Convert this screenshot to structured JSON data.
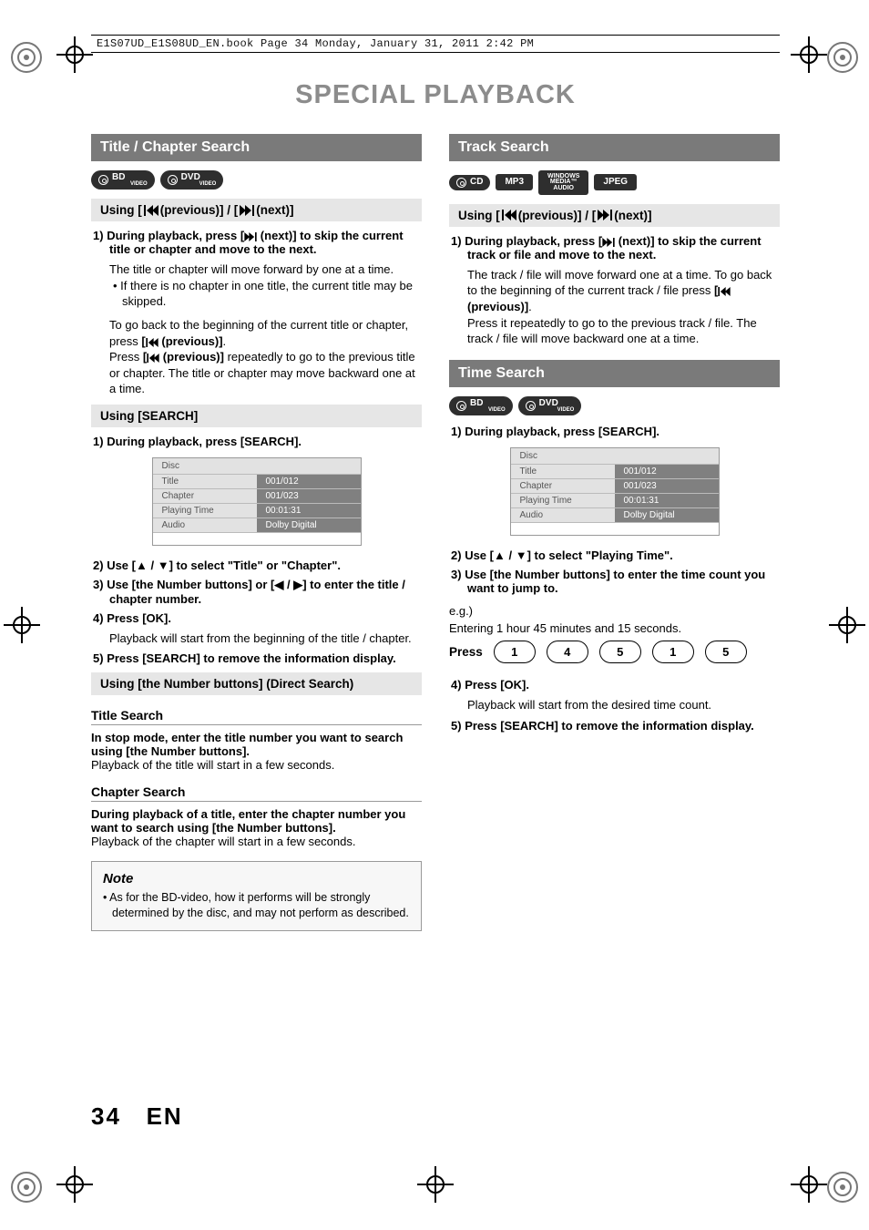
{
  "bookline": "E1S07UD_E1S08UD_EN.book  Page 34  Monday, January 31, 2011  2:42 PM",
  "main_title": "SPECIAL PLAYBACK",
  "icons": {
    "prev": "|◀◀ (previous)",
    "next": "▶▶| (next)",
    "up": "▲",
    "down": "▼",
    "left": "◀",
    "right": "▶"
  },
  "left": {
    "section_title": "Title / Chapter Search",
    "media": [
      "BD VIDEO",
      "DVD VIDEO"
    ],
    "sub1_prefix": "Using [",
    "sub1_mid": " (previous)] / [",
    "sub1_suffix": " (next)]",
    "s1": {
      "num": "1)",
      "bold_a": "During playback, press [",
      "bold_b": " (next)] to skip the current title or chapter and move to the next.",
      "line2": "The title or chapter will move forward by one at a time.",
      "bullet": "If there is no chapter in one title, the current title may be skipped.",
      "line3a": "To go back to the beginning of the current title or chapter, press ",
      "line3b_bold_pre": "[",
      "line3b_bold_post": " (previous)]",
      "line3b_end": ".",
      "line4a": "Press ",
      "line4b_bold_pre": "[",
      "line4b_bold_post": " (previous)]",
      "line4c": " repeatedly to go to the previous title or chapter. The title or chapter may move backward one at a time."
    },
    "sub2": "Using [SEARCH]",
    "s2_1": {
      "num": "1)",
      "bold": "During playback, press [SEARCH]."
    },
    "osd": {
      "hdr": "Disc",
      "rows": [
        {
          "k": "Title",
          "v": "001/012"
        },
        {
          "k": "Chapter",
          "v": "001/023"
        },
        {
          "k": "Playing Time",
          "v": "00:01:31"
        },
        {
          "k": "Audio",
          "v": "Dolby Digital"
        }
      ]
    },
    "s2_2": {
      "num": "2)",
      "pre": "Use [",
      "mid": " / ",
      "post": "] to select \"Title\" or \"Chapter\"."
    },
    "s2_3": {
      "num": "3)",
      "pre": "Use [the Number buttons] or [",
      "mid": " / ",
      "post": "] to enter the title / chapter number."
    },
    "s2_4": {
      "num": "4)",
      "bold": "Press [OK].",
      "sub": "Playback will start from the beginning of the title / chapter."
    },
    "s2_5": {
      "num": "5)",
      "bold": "Press [SEARCH] to remove the information display."
    },
    "sub3": "Using [the Number buttons] (Direct Search)",
    "ts_h": "Title Search",
    "ts_bold": "In stop mode, enter the title number you want to search using [the Number buttons].",
    "ts_line": "Playback of the title will start in a few seconds.",
    "cs_h": "Chapter Search",
    "cs_bold": "During playback of a title, enter the chapter number you want to search using [the Number buttons].",
    "cs_line": "Playback of the chapter will start in a few seconds.",
    "note_h": "Note",
    "note_b": "As for the BD-video, how it performs will be strongly determined by the disc, and may not perform as described."
  },
  "right": {
    "section_title": "Track Search",
    "media": [
      "CD",
      "MP3",
      "WINDOWS MEDIA AUDIO",
      "JPEG"
    ],
    "sub1_prefix": "Using [",
    "sub1_mid": " (previous)] / [",
    "sub1_suffix": " (next)]",
    "s1": {
      "num": "1)",
      "bold_a": "During playback, press [",
      "bold_b": " (next)] to skip the current track or file and move to the next.",
      "line2a": "The track / file will move forward one at a time. To go back to the beginning of the current track / file press ",
      "line2b_bold_pre": "[",
      "line2b_bold_post": " (previous)]",
      "line2b_end": ".",
      "line3": "Press it repeatedly to go to the previous track / file. The track / file will move backward one at a time."
    },
    "time_title": "Time Search",
    "time_media": [
      "BD VIDEO",
      "DVD VIDEO"
    ],
    "t1": {
      "num": "1)",
      "bold": "During playback, press [SEARCH]."
    },
    "osd": {
      "hdr": "Disc",
      "rows": [
        {
          "k": "Title",
          "v": "001/012"
        },
        {
          "k": "Chapter",
          "v": "001/023"
        },
        {
          "k": "Playing Time",
          "v": "00:01:31"
        },
        {
          "k": "Audio",
          "v": "Dolby Digital"
        }
      ]
    },
    "t2": {
      "num": "2)",
      "pre": "Use [",
      "mid": " / ",
      "post": "] to select \"Playing Time\"."
    },
    "t3": {
      "num": "3)",
      "bold": "Use [the Number buttons] to enter the time count you want to jump to."
    },
    "eg_lbl": "e.g.)",
    "eg_line": "Entering 1 hour 45 minutes and 15 seconds.",
    "press_lbl": "Press",
    "press_keys": [
      "1",
      "4",
      "5",
      "1",
      "5"
    ],
    "t4": {
      "num": "4)",
      "bold": "Press [OK].",
      "sub": "Playback will start from the desired time count."
    },
    "t5": {
      "num": "5)",
      "bold": "Press [SEARCH] to remove the information display."
    }
  },
  "footer_page": "34",
  "footer_lang": "EN"
}
